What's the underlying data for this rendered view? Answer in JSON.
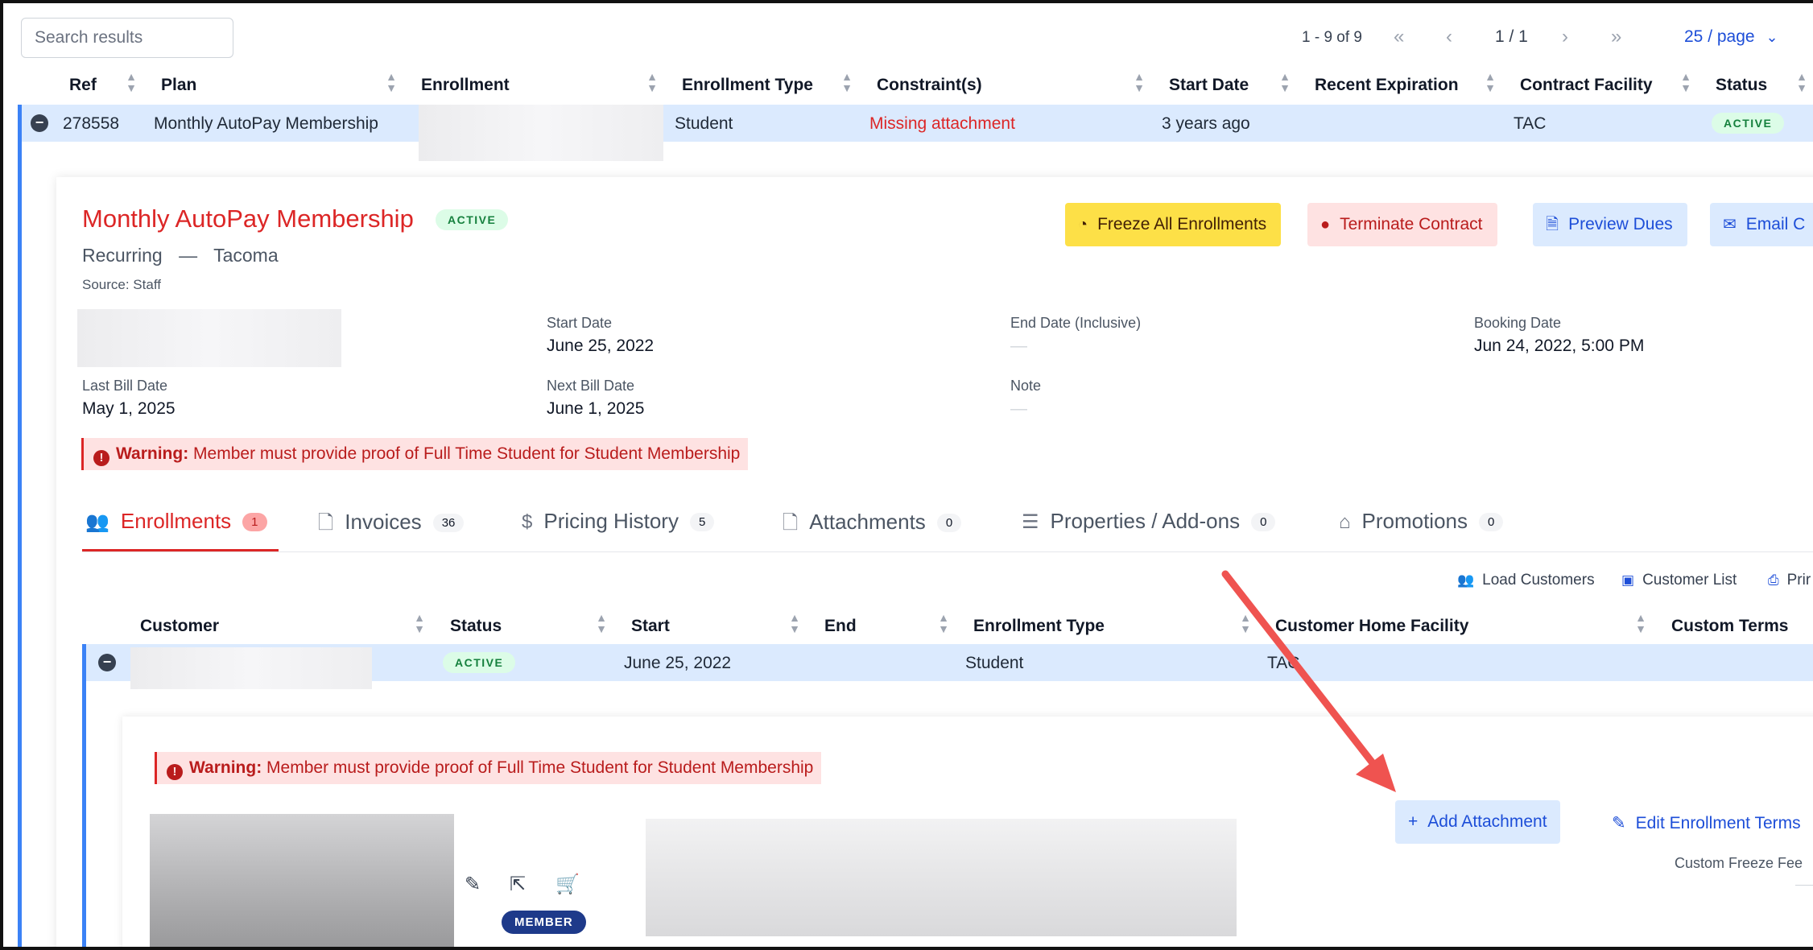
{
  "toolbar": {
    "search_placeholder": "Search results",
    "range_text": "1 - 9 of 9",
    "first_icon": "«",
    "prev_icon": "‹",
    "page_text": "1 / 1",
    "next_icon": "›",
    "last_icon": "»",
    "page_size": "25 / page",
    "page_size_chevron": "⌄"
  },
  "table": {
    "headers": [
      "Ref",
      "Plan",
      "Enrollment",
      "Enrollment Type",
      "Constraint(s)",
      "Start Date",
      "Recent Expiration",
      "Contract Facility",
      "Status"
    ],
    "row": {
      "ref": "278558",
      "plan": "Monthly AutoPay Membership",
      "enrollment_type": "Student",
      "constraint": "Missing attachment",
      "start_date": "3 years ago",
      "contract_facility": "TAC",
      "status": "ACTIVE"
    }
  },
  "detail": {
    "title": "Monthly AutoPay Membership",
    "status": "ACTIVE",
    "subtitle_type": "Recurring",
    "subtitle_sep": "—",
    "subtitle_location": "Tacoma",
    "source": "Source: Staff",
    "buttons": {
      "freeze": "Freeze All Enrollments",
      "terminate": "Terminate Contract",
      "preview": "Preview Dues",
      "email": "Email C"
    },
    "fields": {
      "start_date_label": "Start Date",
      "start_date_value": "June 25, 2022",
      "end_date_label": "End Date (Inclusive)",
      "end_date_value": "—",
      "booking_date_label": "Booking Date",
      "booking_date_value": "Jun 24, 2022, 5:00 PM",
      "last_bill_label": "Last Bill Date",
      "last_bill_value": "May 1, 2025",
      "next_bill_label": "Next Bill Date",
      "next_bill_value": "June 1, 2025",
      "note_label": "Note",
      "note_value": "—"
    },
    "warning_label": "Warning:",
    "warning_text": " Member must provide proof of Full Time Student for Student Membership"
  },
  "tabs": [
    {
      "label": "Enrollments",
      "count": "1"
    },
    {
      "label": "Invoices",
      "count": "36"
    },
    {
      "label": "Pricing History",
      "count": "5"
    },
    {
      "label": "Attachments",
      "count": "0"
    },
    {
      "label": "Properties / Add-ons",
      "count": "0"
    },
    {
      "label": "Promotions",
      "count": "0"
    }
  ],
  "tools": {
    "load_customers": "Load Customers",
    "customer_list": "Customer List",
    "print": "Prir"
  },
  "enrollments_table": {
    "headers": [
      "Customer",
      "Status",
      "Start",
      "End",
      "Enrollment Type",
      "Customer Home Facility",
      "Custom Terms"
    ],
    "row": {
      "status": "ACTIVE",
      "start": "June 25, 2022",
      "enrollment_type": "Student",
      "home_facility": "TAC"
    }
  },
  "enrollment_detail": {
    "warning_label": "Warning:",
    "warning_text": " Member must provide proof of Full Time Student for Student Membership",
    "add_attachment": "Add Attachment",
    "edit_terms": "Edit Enrollment Terms",
    "custom_freeze_fee": "Custom Freeze Fee",
    "member_badge": "MEMBER"
  },
  "colors": {
    "accent_red": "#dc2626",
    "link_blue": "#1d4ed8",
    "row_highlight": "#dbeafe",
    "arrow": "#ef5350"
  }
}
